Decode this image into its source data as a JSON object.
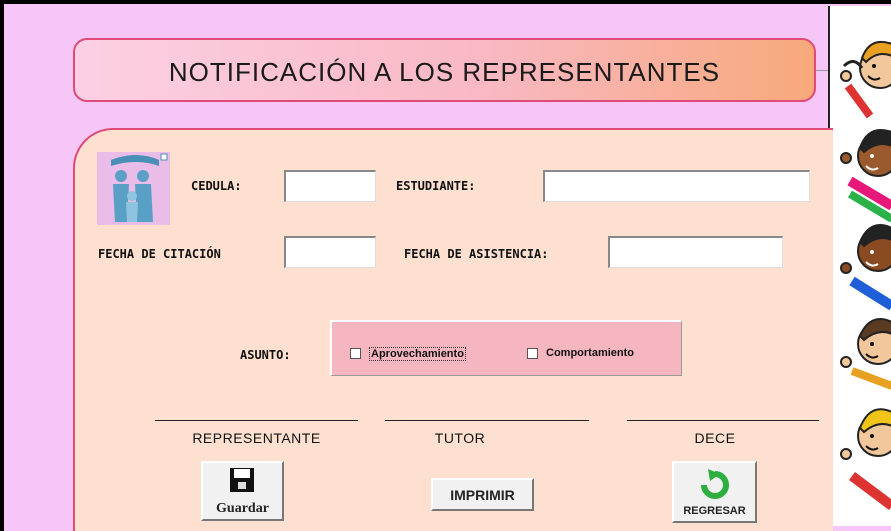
{
  "title": "NOTIFICACIÓN A LOS REPRESENTANTES",
  "form": {
    "cedula_label": "CEDULA:",
    "cedula_value": "",
    "estudiante_label": "ESTUDIANTE:",
    "estudiante_value": "",
    "fecha_citacion_label": "FECHA DE CITACIÓN",
    "fecha_citacion_value": "",
    "fecha_asistencia_label": "FECHA DE ASISTENCIA:",
    "fecha_asistencia_value": ""
  },
  "asunto": {
    "label": "ASUNTO:",
    "options": [
      {
        "label": "Aprovechamiento",
        "checked": false
      },
      {
        "label": "Comportamiento",
        "checked": false
      }
    ]
  },
  "signatures": [
    "REPRESENTANTE",
    "TUTOR",
    "DECE"
  ],
  "buttons": {
    "guardar": "Guardar",
    "imprimir": "IMPRIMIR",
    "regresar": "REGRESAR"
  },
  "icons": {
    "logo": "family-icon",
    "guardar": "floppy-disk-icon",
    "regresar": "return-arrow-icon",
    "side": "kids-illustration-icon"
  },
  "colors": {
    "background": "#f6c6f6",
    "form_panel": "#fde0cf",
    "border": "#e04a78",
    "asunto_box": "#f5b6c0"
  }
}
